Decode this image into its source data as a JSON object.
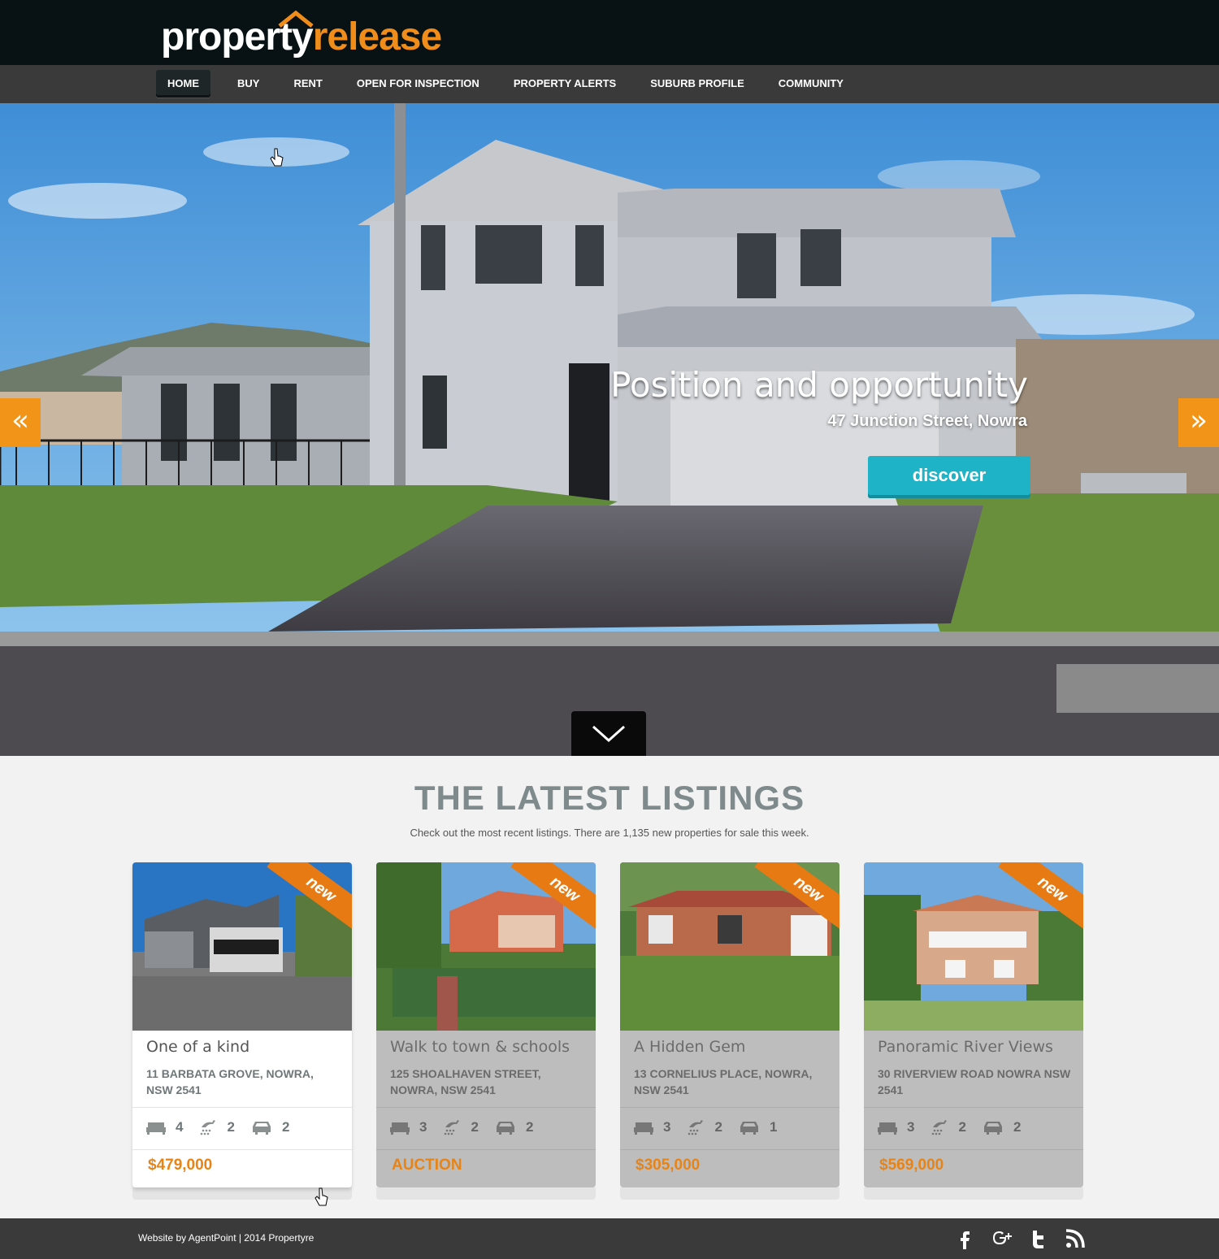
{
  "brand": {
    "part1": "property",
    "part2": "release"
  },
  "nav": {
    "items": [
      "HOME",
      "BUY",
      "RENT",
      "OPEN FOR INSPECTION",
      "PROPERTY ALERTS",
      "SUBURB PROFILE",
      "COMMUNITY"
    ],
    "active": "HOME"
  },
  "hero": {
    "title": "Position and opportunity",
    "address": "47 Junction Street, Nowra",
    "button": "discover",
    "prev_icon": "«",
    "next_icon": "»",
    "scroll_icon": "chevron-down-icon"
  },
  "listings": {
    "heading": "THE LATEST LISTINGS",
    "subheading": "Check out the most recent listings. There are 1,135 new properties for sale this week.",
    "badge": "new",
    "cards": [
      {
        "title": "One of a kind",
        "address": "11 BARBATA GROVE, NOWRA, NSW 2541",
        "beds": "4",
        "baths": "2",
        "cars": "2",
        "price": "$479,000"
      },
      {
        "title": "Walk to town & schools",
        "address": "125 SHOALHAVEN STREET, NOWRA, NSW 2541",
        "beds": "3",
        "baths": "2",
        "cars": "2",
        "price": "AUCTION"
      },
      {
        "title": "A Hidden Gem",
        "address": "13 CORNELIUS PLACE, NOWRA, NSW 2541",
        "beds": "3",
        "baths": "2",
        "cars": "1",
        "price": "$305,000"
      },
      {
        "title": "Panoramic River Views",
        "address": "30 RIVERVIEW ROAD NOWRA NSW 2541",
        "beds": "3",
        "baths": "2",
        "cars": "2",
        "price": "$569,000"
      }
    ]
  },
  "footer": {
    "text": "Website by AgentPoint | 2014  Propertyre",
    "social": [
      "facebook-icon",
      "google-plus-icon",
      "twitter-icon",
      "rss-icon"
    ]
  },
  "colors": {
    "accent": "#f08c1a",
    "teal": "#1eb3c7",
    "dark": "#081214",
    "nav": "#3a3a3a"
  }
}
